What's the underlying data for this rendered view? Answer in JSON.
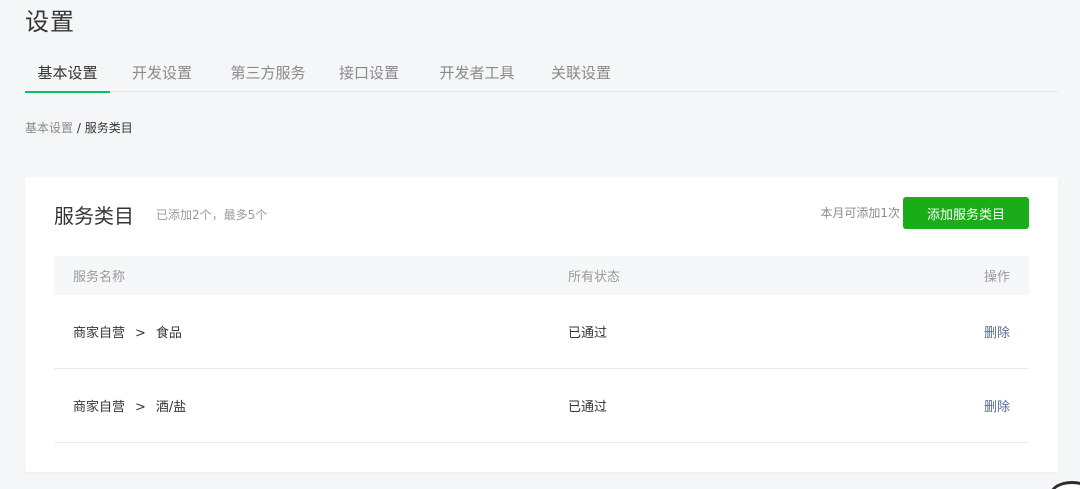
{
  "page": {
    "title": "设置"
  },
  "tabs": [
    {
      "label": "基本设置",
      "active": true
    },
    {
      "label": "开发设置",
      "active": false
    },
    {
      "label": "第三方服务",
      "active": false
    },
    {
      "label": "接口设置",
      "active": false
    },
    {
      "label": "开发者工具",
      "active": false
    },
    {
      "label": "关联设置",
      "active": false
    }
  ],
  "breadcrumb": {
    "parent": "基本设置",
    "separator": "/",
    "current": "服务类目"
  },
  "card": {
    "title": "服务类目",
    "subtitle": "已添加2个，最多5个",
    "quota": "本月可添加1次",
    "add_button": "添加服务类目"
  },
  "table": {
    "headers": {
      "name": "服务名称",
      "status": "所有状态",
      "operation": "操作"
    },
    "rows": [
      {
        "category": "商家自营",
        "separator": ">",
        "subcategory": "食品",
        "status": "已通过",
        "action": "删除"
      },
      {
        "category": "商家自营",
        "separator": ">",
        "subcategory": "酒/盐",
        "status": "已通过",
        "action": "删除"
      }
    ]
  },
  "colors": {
    "accent": "#07c160",
    "button": "#1aad19",
    "link": "#576b95"
  }
}
